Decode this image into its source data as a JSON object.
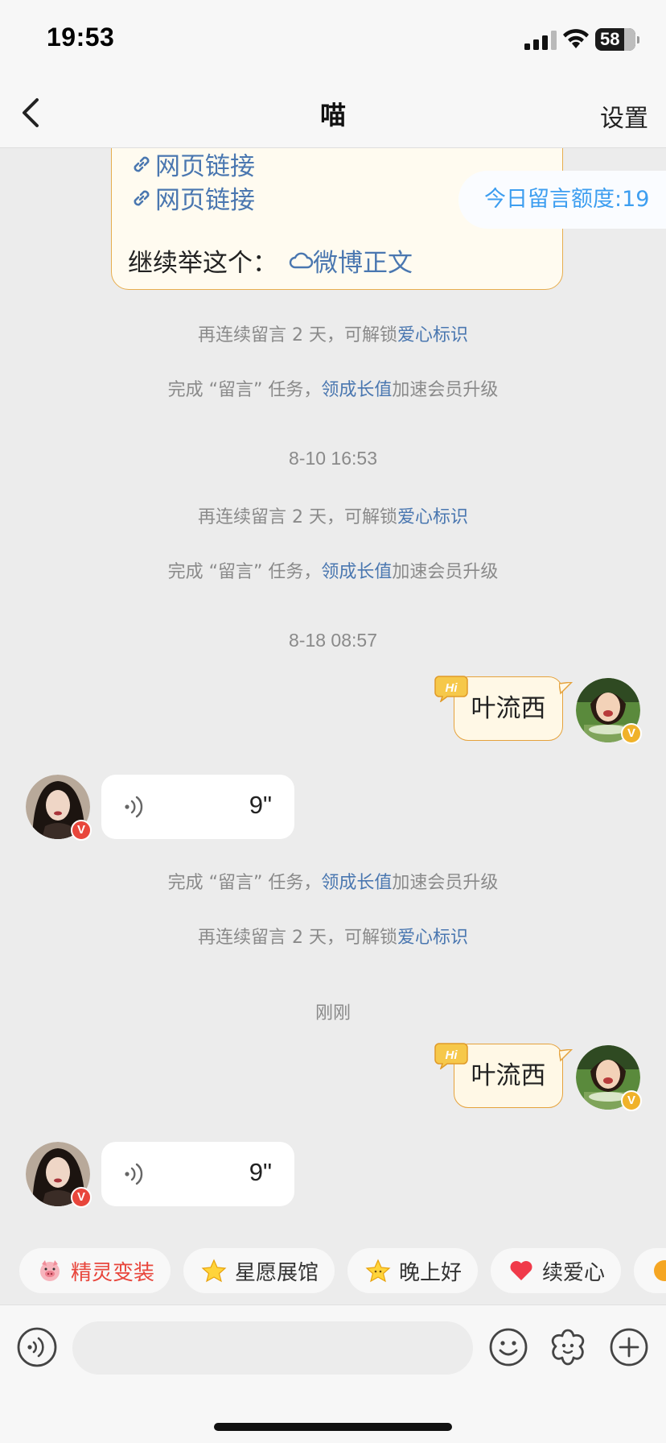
{
  "status": {
    "time": "19:53",
    "battery": "58"
  },
  "nav": {
    "back_icon": "chevron-left-icon",
    "title": "喵",
    "settings_label": "设置"
  },
  "card": {
    "link1": "网页链接",
    "link2": "网页链接",
    "continue_label": "继续举这个：",
    "weibo_link": "微博正文"
  },
  "quota": {
    "label": "今日留言额度:19"
  },
  "system_messages": {
    "unlock_prefix": "再连续留言 2 天，可解锁",
    "unlock_link": "爱心标识",
    "task_prefix": "完成 “留言” 任务，",
    "task_link": "领成长值",
    "task_suffix": "加速会员升级"
  },
  "timestamps": {
    "t1": "8-10 16:53",
    "t2": "8-18 08:57",
    "t3": "刚刚"
  },
  "messages": {
    "sent1": "叶流西",
    "voice1_duration": "9\"",
    "sent2": "叶流西",
    "voice2_duration": "9\""
  },
  "chips": [
    {
      "label": "精灵变装",
      "icon": "pig-face-icon",
      "color": "#e8463c"
    },
    {
      "label": "星愿展馆",
      "icon": "star-icon",
      "color": "#333333"
    },
    {
      "label": "晚上好",
      "icon": "star-icon",
      "color": "#333333"
    },
    {
      "label": "续爱心",
      "icon": "heart-icon",
      "color": "#333333"
    }
  ],
  "input": {
    "voice_icon": "voice-input-icon",
    "emoji_icon": "emoji-icon",
    "sticker_icon": "sticker-flower-icon",
    "plus_icon": "plus-circle-icon"
  },
  "colors": {
    "link_blue": "#4a77b0",
    "quota_blue": "#3d9ef0",
    "bubble_border": "#e5a23c",
    "vip_red": "#e8463c",
    "vip_gold": "#f0b22a"
  }
}
